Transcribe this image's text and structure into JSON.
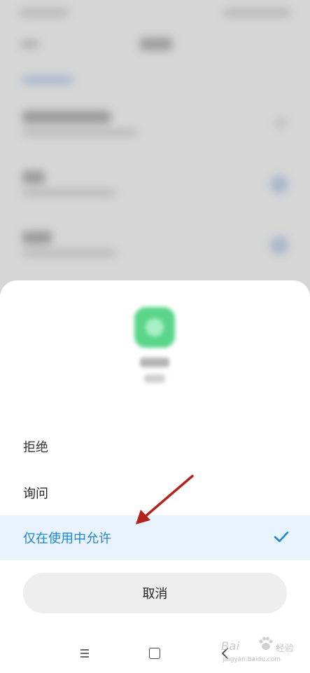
{
  "permission_sheet": {
    "options": [
      {
        "label": "拒绝",
        "selected": false
      },
      {
        "label": "询问",
        "selected": false
      },
      {
        "label": "仅在使用中允许",
        "selected": true
      }
    ],
    "cancel_label": "取消"
  },
  "system_nav": {
    "icons": [
      "menu-icon",
      "home-icon",
      "back-icon"
    ]
  },
  "watermark": {
    "brand": "Bai",
    "brand_suffix": "经验",
    "url": "jingyan.baidu.com"
  },
  "colors": {
    "accent": "#1f86d8",
    "selected_row_bg": "#e9f3fd",
    "annotation_arrow": "#b5221c",
    "app_icon": "#5ad58a"
  }
}
